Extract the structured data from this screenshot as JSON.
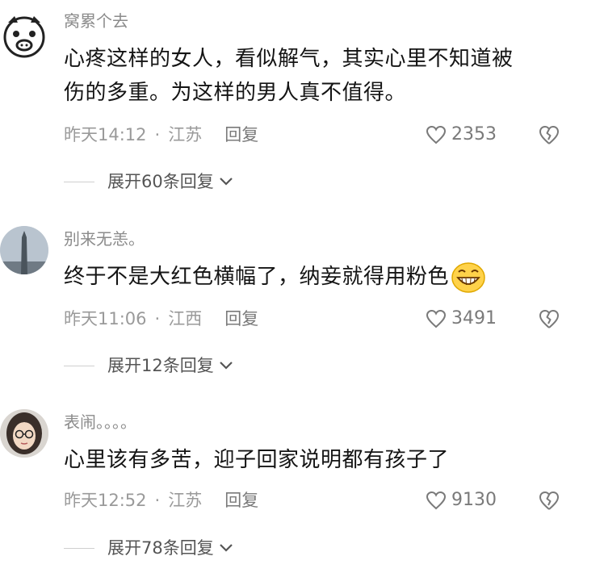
{
  "comments": [
    {
      "username": "窝累个去",
      "avatar": "doodle-face-avatar",
      "content_lines": [
        "心疼这样的女人，看似解气，其实心里不知道被",
        "伤的多重。为这样的男人真不值得。"
      ],
      "time": "昨天14:12",
      "separator": "·",
      "location": "江苏",
      "reply_label": "回复",
      "likes": "2353",
      "expand_label": "展开60条回复"
    },
    {
      "username": "别来无恙。",
      "avatar": "tower-photo-avatar",
      "content_lines": [
        "终于不是大红色横幅了，纳妾就得用粉色"
      ],
      "emoji": "grin-emoji",
      "time": "昨天11:06",
      "separator": "·",
      "location": "江西",
      "reply_label": "回复",
      "likes": "3491",
      "expand_label": "展开12条回复"
    },
    {
      "username": "表闹。。。。",
      "avatar": "girl-glasses-avatar",
      "content_lines": [
        "心里该有多苦，迎子回家说明都有孩子了"
      ],
      "time": "昨天12:52",
      "separator": "·",
      "location": "江苏",
      "reply_label": "回复",
      "likes": "9130",
      "expand_label": "展开78条回复"
    }
  ],
  "icons": {
    "like": "heart-outline-icon",
    "dislike": "broken-heart-icon",
    "expand": "chevron-down-icon"
  }
}
